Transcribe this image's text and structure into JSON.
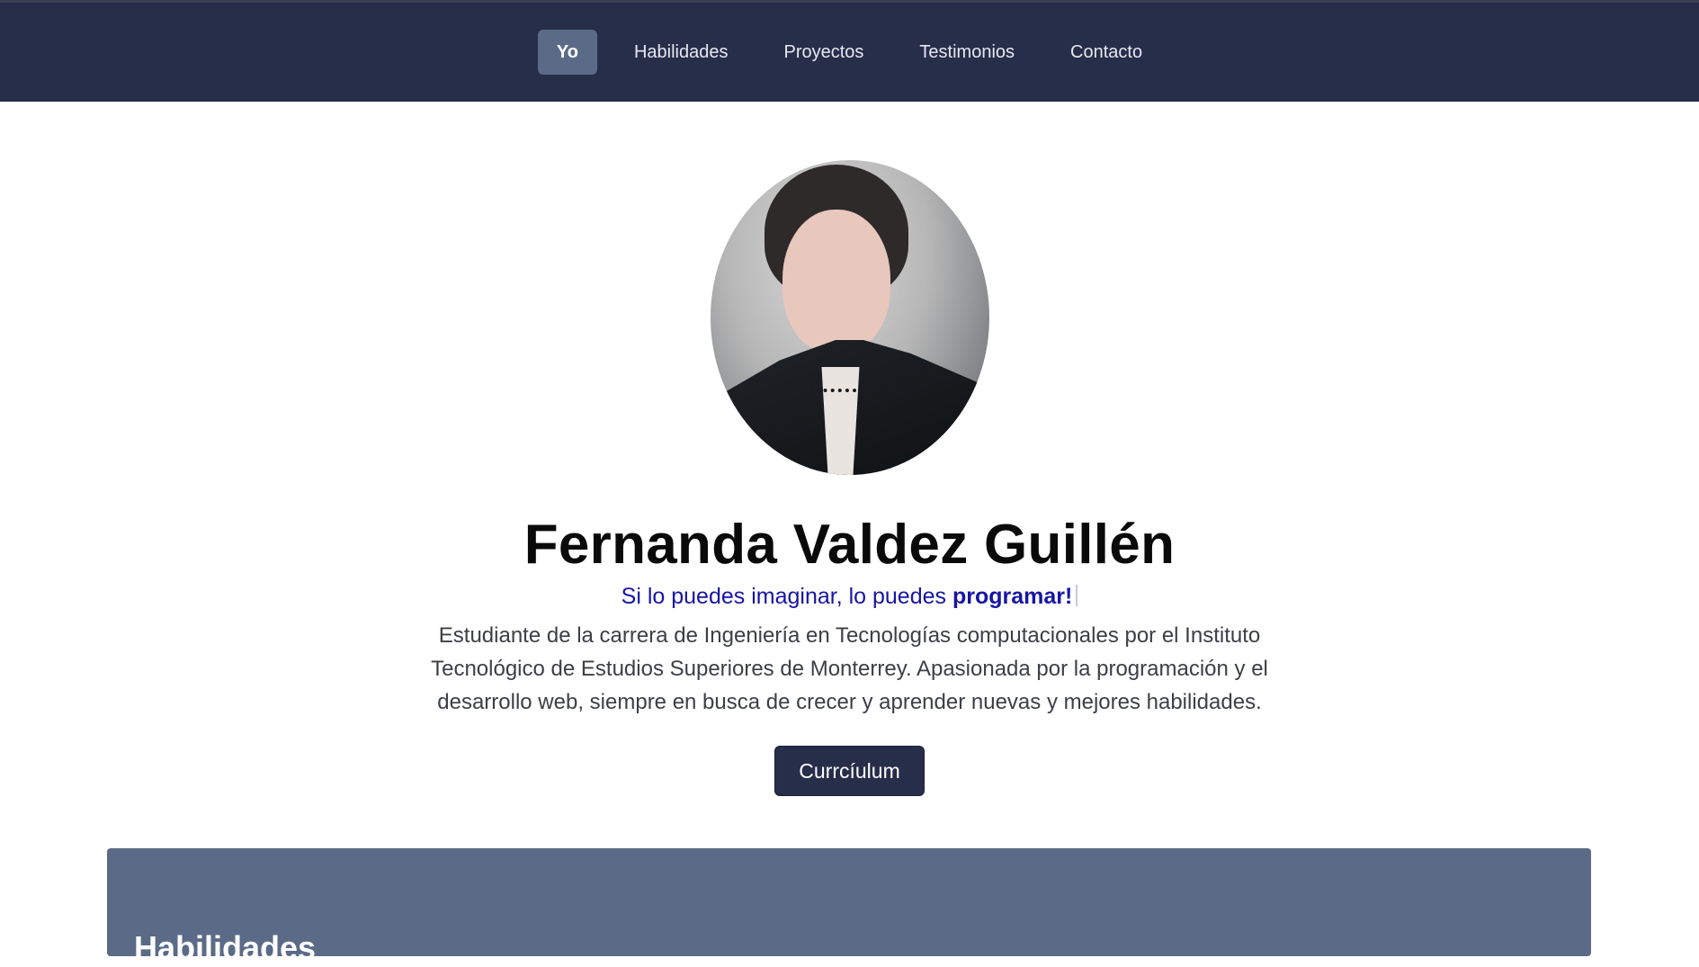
{
  "nav": {
    "items": [
      {
        "label": "Yo",
        "active": true
      },
      {
        "label": "Habilidades",
        "active": false
      },
      {
        "label": "Proyectos",
        "active": false
      },
      {
        "label": "Testimonios",
        "active": false
      },
      {
        "label": "Contacto",
        "active": false
      }
    ]
  },
  "hero": {
    "name": "Fernanda Valdez Guillén",
    "tagline_prefix": "Si lo puedes imaginar, lo puedes ",
    "tagline_emphasis": "programar!",
    "bio": "Estudiante de la carrera de Ingeniería en Tecnologías computacionales por el Instituto Tecnológico de Estudios Superiores de Monterrey. Apasionada por la programación y el desarrollo web, siempre en busca de crecer y aprender nuevas y mejores habilidades.",
    "cv_button": "Currcíulum"
  },
  "skills": {
    "title": "Habilidades"
  },
  "colors": {
    "nav_bg": "#272e4a",
    "nav_active": "#5b6b87",
    "tagline": "#1715a3",
    "panel_bg": "#5b6b87"
  },
  "icons": {
    "avatar": "profile-photo"
  }
}
